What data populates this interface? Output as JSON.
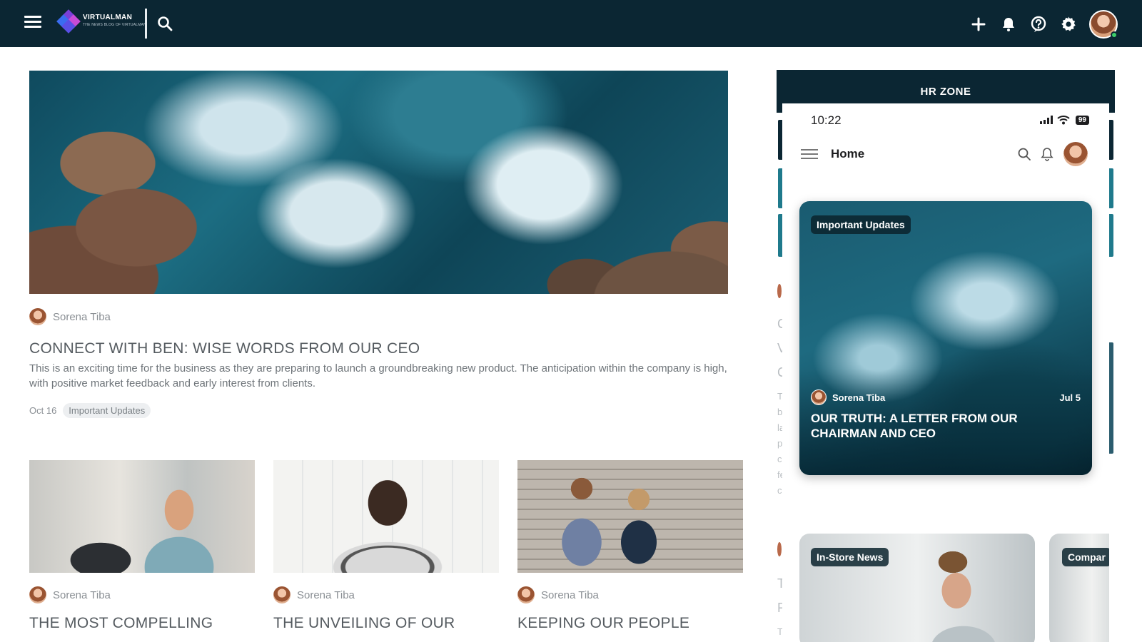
{
  "topbar": {
    "logo_text": "VIRTUALMAN",
    "logo_tagline": "THE NEWS BLOG OF VIRTUALMAN",
    "icons": [
      "menu-icon",
      "search-icon",
      "plus-icon",
      "bell-icon",
      "help-icon",
      "gear-icon"
    ]
  },
  "hero": {
    "author": "Sorena Tiba",
    "title": "CONNECT WITH BEN: WISE WORDS FROM OUR CEO",
    "excerpt": "This is an exciting time for the business as they are preparing to launch a groundbreaking new product. The anticipation within the company is high, with positive market feedback and early interest from clients.",
    "date": "Oct 16",
    "tag": "Important Updates"
  },
  "cards": [
    {
      "author": "Sorena Tiba",
      "title": "THE MOST COMPELLING"
    },
    {
      "author": "Sorena Tiba",
      "title": "THE UNVEILING OF OUR"
    },
    {
      "author": "Sorena Tiba",
      "title": "KEEPING OUR PEOPLE"
    }
  ],
  "hrzone": {
    "title": "HR ZONE",
    "peek_letters": [
      "C",
      "V",
      "C",
      "T",
      "b",
      "la",
      "p",
      "c",
      "fe",
      "c",
      "T",
      "F",
      "T"
    ]
  },
  "phone": {
    "time": "10:22",
    "battery": "99",
    "screen_title": "Home",
    "featured": {
      "tag": "Important Updates",
      "author": "Sorena Tiba",
      "date": "Jul 5",
      "title": "OUR TRUTH: A LETTER FROM OUR CHAIRMAN AND CEO"
    },
    "more_cards": [
      {
        "tag": "In-Store News"
      },
      {
        "tag": "Compar"
      }
    ]
  },
  "colors": {
    "topbar_bg": "#0b2633",
    "accent_teal": "#1f7a8c",
    "text_muted": "#8a8f94"
  }
}
